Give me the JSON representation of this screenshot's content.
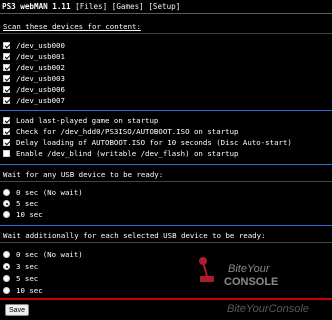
{
  "header": {
    "title": "PS3 webMAN 1.11",
    "links": [
      "Files",
      "Games",
      "Setup"
    ]
  },
  "scan_section": {
    "title": "Scan these devices for content:",
    "devices": [
      {
        "label": "/dev_usb000",
        "checked": true
      },
      {
        "label": "/dev_usb001",
        "checked": true
      },
      {
        "label": "/dev_usb002",
        "checked": true
      },
      {
        "label": "/dev_usb003",
        "checked": true
      },
      {
        "label": "/dev_usb006",
        "checked": true
      },
      {
        "label": "/dev_usb007",
        "checked": true
      }
    ]
  },
  "options": [
    {
      "label": "Load last-played game on startup",
      "checked": true
    },
    {
      "label": "Check for /dev_hdd0/PS3ISO/AUTOBOOT.ISO on startup",
      "checked": true
    },
    {
      "label": "Delay loading of AUTOBOOT.ISO for 10 seconds (Disc Auto-start)",
      "checked": true
    },
    {
      "label": "Enable /dev_blind (writable /dev_flash) on startup",
      "checked": false
    }
  ],
  "wait_any": {
    "title": "Wait for any USB device to be ready:",
    "options": [
      {
        "label": "0 sec (No wait)",
        "checked": false
      },
      {
        "label": "5 sec",
        "checked": true
      },
      {
        "label": "10 sec",
        "checked": false
      }
    ]
  },
  "wait_each": {
    "title": "Wait additionally for each selected USB device to be ready:",
    "options": [
      {
        "label": "0 sec (No wait)",
        "checked": false
      },
      {
        "label": "3 sec",
        "checked": true
      },
      {
        "label": "5 sec",
        "checked": false
      },
      {
        "label": "10 sec",
        "checked": false
      }
    ]
  },
  "save_label": "Save",
  "watermark": {
    "logo_text": "BiteYourCONSOLE",
    "bottom_text": "BiteYourConsole"
  },
  "colors": {
    "background": "#000000",
    "text": "#ffffff",
    "separator_blue": "#2f6fd0",
    "separator_red": "#cc0000",
    "watermark_red": "#cc2233"
  }
}
